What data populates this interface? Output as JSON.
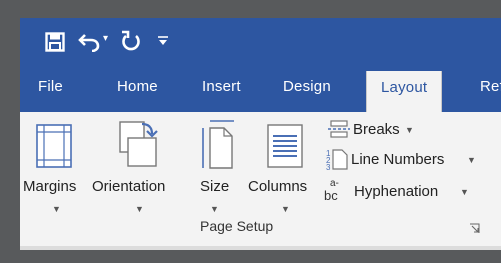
{
  "qat": {
    "save_icon": "save-icon",
    "undo_icon": "undo-icon",
    "redo_icon": "redo-icon",
    "customize_icon": "customize-qat-icon"
  },
  "tabs": [
    {
      "label": "File"
    },
    {
      "label": "Home"
    },
    {
      "label": "Insert"
    },
    {
      "label": "Design"
    },
    {
      "label": "Layout",
      "active": true
    },
    {
      "label": "Ref"
    }
  ],
  "ribbon": {
    "page_setup": {
      "group_label": "Page Setup",
      "margins": "Margins",
      "orientation": "Orientation",
      "size": "Size",
      "columns": "Columns",
      "breaks": "Breaks",
      "line_numbers": "Line Numbers",
      "hyphenation": "Hyphenation"
    }
  },
  "colors": {
    "accent": "#2d56a1",
    "ribbon_bg": "#f3f3f3",
    "frame": "#585a5c"
  }
}
